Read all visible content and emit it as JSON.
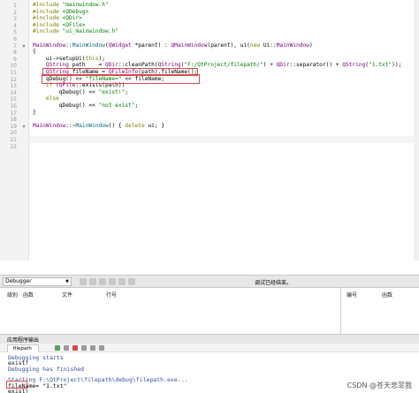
{
  "editor": {
    "line_numbers": [
      "1",
      "2",
      "3",
      "4",
      "5",
      "6",
      "7",
      "8",
      "9",
      "10",
      "11",
      "12",
      "13",
      "14",
      "15",
      "16",
      "17",
      "18",
      "19",
      "20",
      "21",
      "22"
    ],
    "lines": [
      {
        "segments": [
          {
            "t": "#include ",
            "c": "kw"
          },
          {
            "t": "\"mainwindow.h\"",
            "c": "str"
          }
        ]
      },
      {
        "segments": [
          {
            "t": "#include ",
            "c": "kw"
          },
          {
            "t": "<QDebug>",
            "c": "str"
          }
        ]
      },
      {
        "segments": [
          {
            "t": "#include ",
            "c": "kw"
          },
          {
            "t": "<QDir>",
            "c": "str"
          }
        ]
      },
      {
        "segments": [
          {
            "t": "#include ",
            "c": "kw"
          },
          {
            "t": "<QFile>",
            "c": "str"
          }
        ]
      },
      {
        "segments": [
          {
            "t": "#include ",
            "c": "kw"
          },
          {
            "t": "\"ui_mainwindow.h\"",
            "c": "str"
          }
        ]
      },
      {
        "segments": []
      },
      {
        "segments": [
          {
            "t": "MainWindow",
            "c": "cls"
          },
          {
            "t": "::",
            "c": ""
          },
          {
            "t": "MainWindow",
            "c": "fn"
          },
          {
            "t": "(",
            "c": ""
          },
          {
            "t": "QWidget",
            "c": "cls"
          },
          {
            "t": " *parent) : ",
            "c": ""
          },
          {
            "t": "QMainWindow",
            "c": "cls"
          },
          {
            "t": "(parent), ui(",
            "c": ""
          },
          {
            "t": "new",
            "c": "kw"
          },
          {
            "t": " Ui::",
            "c": ""
          },
          {
            "t": "MainWindow",
            "c": "cls"
          },
          {
            "t": ")",
            "c": ""
          }
        ]
      },
      {
        "segments": [
          {
            "t": "{",
            "c": ""
          }
        ]
      },
      {
        "segments": [
          {
            "t": "    ui->setupUi(",
            "c": ""
          },
          {
            "t": "this",
            "c": "kw"
          },
          {
            "t": ");",
            "c": ""
          }
        ]
      },
      {
        "segments": [
          {
            "t": "    ",
            "c": ""
          },
          {
            "t": "QString",
            "c": "cls"
          },
          {
            "t": " path    = ",
            "c": ""
          },
          {
            "t": "QDir",
            "c": "cls"
          },
          {
            "t": "::cleanPath(",
            "c": ""
          },
          {
            "t": "QString",
            "c": "cls"
          },
          {
            "t": "(",
            "c": ""
          },
          {
            "t": "\"F:/QtProject/filepath/\"",
            "c": "str"
          },
          {
            "t": ") + ",
            "c": ""
          },
          {
            "t": "QDir",
            "c": "cls"
          },
          {
            "t": "::separator() + ",
            "c": ""
          },
          {
            "t": "QString",
            "c": "cls"
          },
          {
            "t": "(",
            "c": ""
          },
          {
            "t": "\"1.txt\"",
            "c": "str"
          },
          {
            "t": "));",
            "c": ""
          }
        ]
      },
      {
        "segments": [
          {
            "t": "    ",
            "c": ""
          },
          {
            "t": "QString",
            "c": "cls"
          },
          {
            "t": " fileName = ",
            "c": ""
          },
          {
            "t": "QFileInfo",
            "c": "cls"
          },
          {
            "t": "(path).fileName();",
            "c": ""
          }
        ]
      },
      {
        "segments": [
          {
            "t": "    qDebug() << ",
            "c": ""
          },
          {
            "t": "\"fileName=\"",
            "c": "str"
          },
          {
            "t": " << fileName;",
            "c": ""
          }
        ]
      },
      {
        "segments": [
          {
            "t": "    ",
            "c": ""
          },
          {
            "t": "if",
            "c": "kw"
          },
          {
            "t": " (",
            "c": ""
          },
          {
            "t": "QFile",
            "c": "cls"
          },
          {
            "t": "::exists(path))",
            "c": ""
          }
        ]
      },
      {
        "segments": [
          {
            "t": "        qDebug() << ",
            "c": ""
          },
          {
            "t": "\"exist!\"",
            "c": "str"
          },
          {
            "t": ";",
            "c": ""
          }
        ]
      },
      {
        "segments": [
          {
            "t": "    ",
            "c": ""
          },
          {
            "t": "else",
            "c": "kw"
          }
        ]
      },
      {
        "segments": [
          {
            "t": "        qDebug() << ",
            "c": ""
          },
          {
            "t": "\"not exist\"",
            "c": "str"
          },
          {
            "t": ";",
            "c": ""
          }
        ]
      },
      {
        "segments": [
          {
            "t": "}",
            "c": ""
          }
        ]
      },
      {
        "segments": []
      },
      {
        "segments": [
          {
            "t": "MainWindow",
            "c": "cls"
          },
          {
            "t": "::~",
            "c": ""
          },
          {
            "t": "MainWindow",
            "c": "fn"
          },
          {
            "t": "() { ",
            "c": ""
          },
          {
            "t": "delete",
            "c": "kw"
          },
          {
            "t": " ui; }",
            "c": ""
          }
        ]
      },
      {
        "segments": []
      },
      {
        "segments": []
      },
      {
        "segments": []
      }
    ]
  },
  "debugger": {
    "combo_label": "Debugger",
    "status": "调试已经结束。"
  },
  "panes": {
    "stack_headers": [
      "级别",
      "函数",
      "文件",
      "行号"
    ],
    "right_headers": [
      "编号",
      "函数"
    ]
  },
  "output": {
    "title": "应用程序输出",
    "tab_label": "filepath",
    "lines": [
      {
        "text": "Debugging starts",
        "c": "blue"
      },
      {
        "text": "exist!",
        "c": ""
      },
      {
        "text": "Debugging has finished",
        "c": "blue"
      },
      {
        "text": "",
        "c": ""
      },
      {
        "text": "Starting F:\\QtProject\\filepath\\debug\\filepath.exe...",
        "c": "blue"
      },
      {
        "text": "fileName= \"1.txt\"",
        "c": ""
      },
      {
        "text": "exist!",
        "c": ""
      }
    ]
  },
  "watermark": "CSDN @苍天悲菲我",
  "colors": {
    "highlight_box": "#d94a4a",
    "string": "#008000",
    "keyword": "#808000",
    "class": "#800080"
  }
}
